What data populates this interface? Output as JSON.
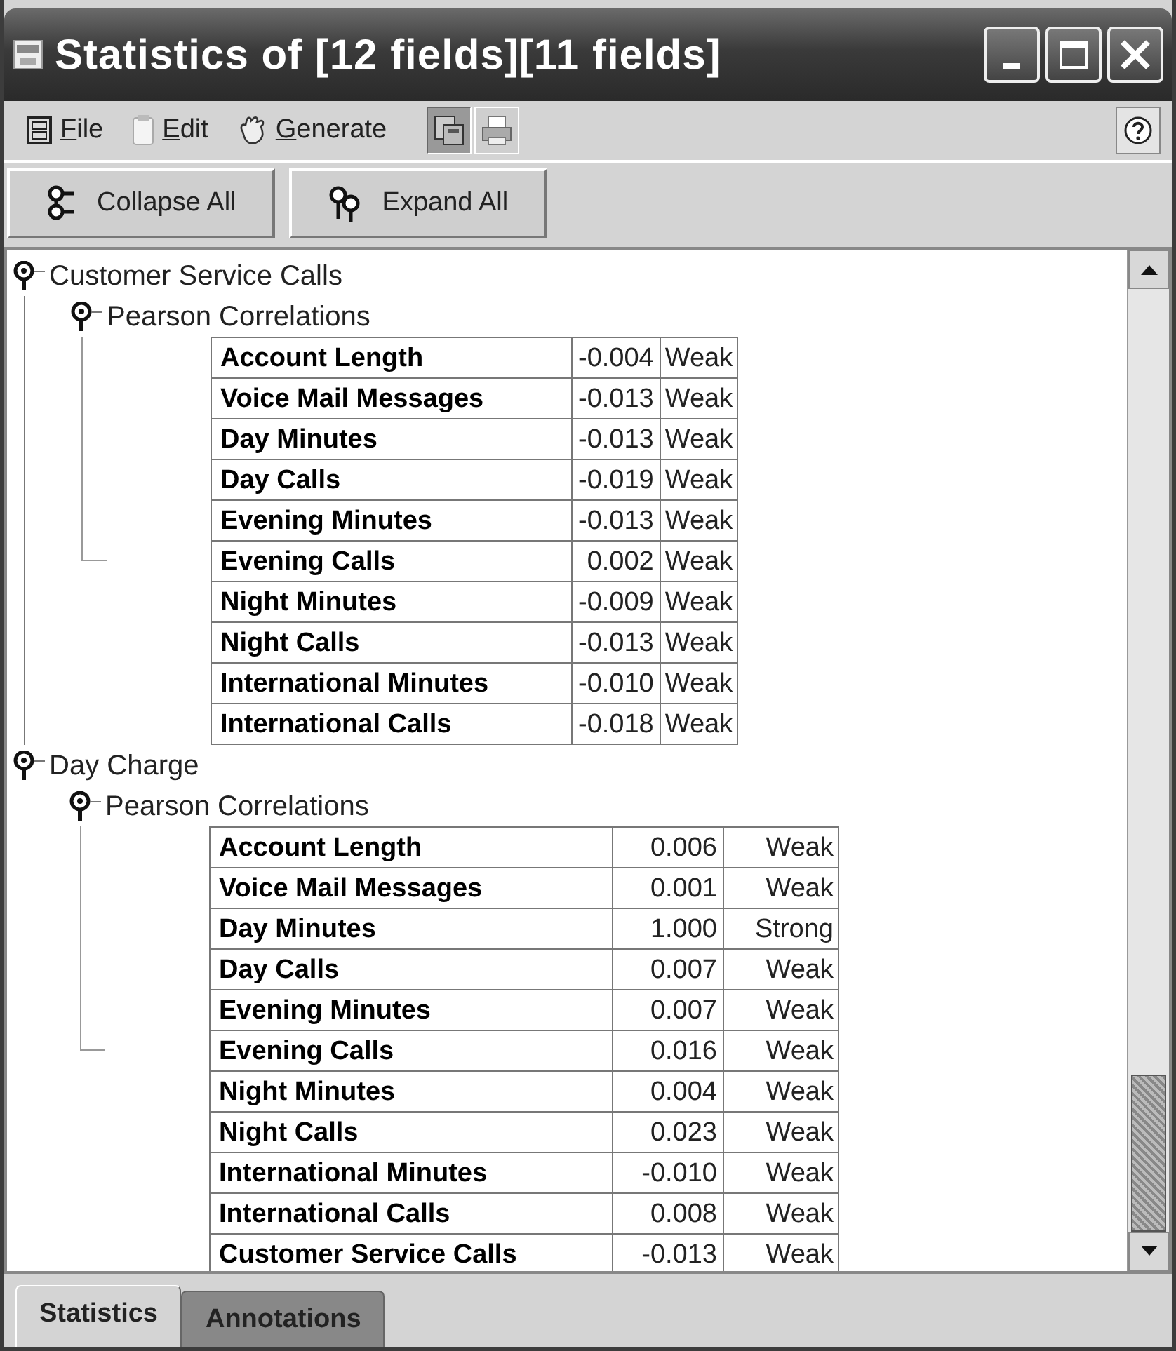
{
  "window": {
    "title": "Statistics of [12 fields][11 fields]"
  },
  "menu": [
    "File",
    "Edit",
    "Generate"
  ],
  "toolbar": [
    {
      "pressed": true
    },
    {
      "pressed": false
    }
  ],
  "buttons": [
    "Collapse All",
    "Expand All"
  ],
  "tree": [
    {
      "label": "Customer Service Calls",
      "expanded": true,
      "children": [
        {
          "label": "Pearson Correlations",
          "expanded": true,
          "rows": [
            [
              "Account Length",
              "-0.004",
              "Weak"
            ],
            [
              "Voice Mail Messages",
              "-0.013",
              "Weak"
            ],
            [
              "Day Minutes",
              "-0.013",
              "Weak"
            ],
            [
              "Day Calls",
              "-0.019",
              "Weak"
            ],
            [
              "Evening Minutes",
              "-0.013",
              "Weak"
            ],
            [
              "Evening Calls",
              "0.002",
              "Weak"
            ],
            [
              "Night Minutes",
              "-0.009",
              "Weak"
            ],
            [
              "Night Calls",
              "-0.013",
              "Weak"
            ],
            [
              "International Minutes",
              "-0.010",
              "Weak"
            ],
            [
              "International Calls",
              "-0.018",
              "Weak"
            ]
          ]
        }
      ]
    },
    {
      "label": "Day Charge",
      "expanded": true,
      "children": [
        {
          "label": "Pearson Correlations",
          "expanded": true,
          "rows": [
            [
              "Account Length",
              "0.006",
              "Weak"
            ],
            [
              "Voice Mail Messages",
              "0.001",
              "Weak"
            ],
            [
              "Day Minutes",
              "1.000",
              "Strong"
            ],
            [
              "Day Calls",
              "0.007",
              "Weak"
            ],
            [
              "Evening Minutes",
              "0.007",
              "Weak"
            ],
            [
              "Evening Calls",
              "0.016",
              "Weak"
            ],
            [
              "Night Minutes",
              "0.004",
              "Weak"
            ],
            [
              "Night Calls",
              "0.023",
              "Weak"
            ],
            [
              "International Minutes",
              "-0.010",
              "Weak"
            ],
            [
              "International Calls",
              "0.008",
              "Weak"
            ],
            [
              "Customer Service Calls",
              "-0.013",
              "Weak"
            ]
          ]
        }
      ]
    }
  ],
  "tabs": [
    {
      "label": "Statistics",
      "selected": true
    },
    {
      "label": "Annotations",
      "selected": false
    }
  ]
}
